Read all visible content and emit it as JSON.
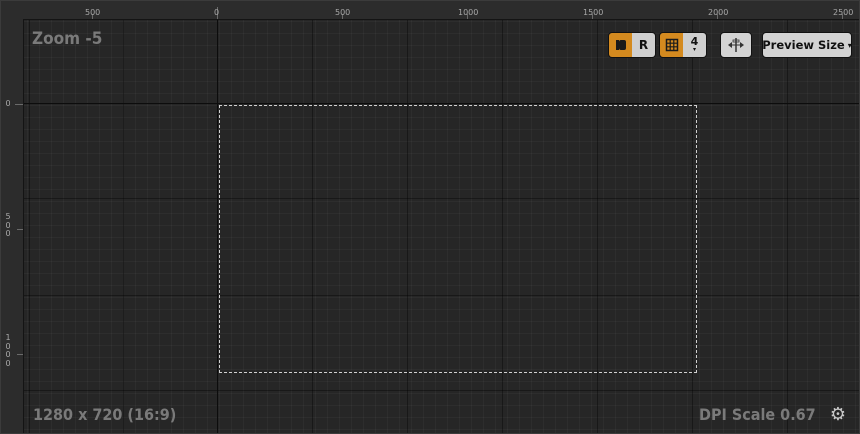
{
  "ruler": {
    "top_labels": [
      "500",
      "0",
      "500",
      "1000",
      "1500",
      "2000",
      "2500"
    ],
    "left_labels": [
      "0",
      "5\n0\n0",
      "1\n0\n0\n0"
    ]
  },
  "canvas": {
    "zoom_label": "Zoom -5",
    "resolution_label": "1280 x 720 (16:9)",
    "dpi_label": "DPI Scale 0.67"
  },
  "toolbar": {
    "respect_locks_icon": "lock-toggle-icon",
    "r_label": "R",
    "grid_icon": "grid-icon",
    "grid_snap_value": "4",
    "flip_icon": "flip-horizontal-icon",
    "preview_size_label": "Preview Size",
    "preview_caret": "▾"
  },
  "settings_icon": "⚙",
  "colors": {
    "accent": "#d48a1f",
    "canvas_bg": "#262626",
    "safe_zone_border": "#d0d0d0"
  }
}
